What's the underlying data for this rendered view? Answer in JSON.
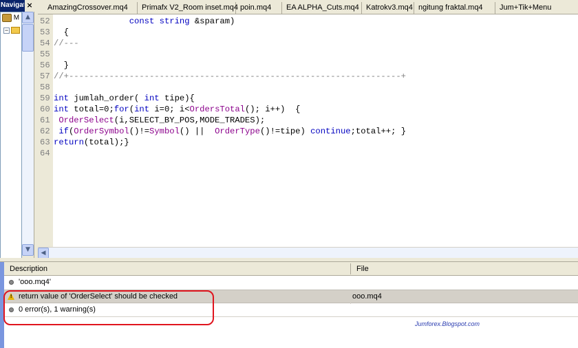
{
  "navigator": {
    "title": "Navigator",
    "close_glyph": "×",
    "tree": [
      {
        "label": "M",
        "icon": "expert-advisor-icon"
      },
      {
        "label": "",
        "icon": "folder-icon"
      }
    ]
  },
  "tabs": [
    {
      "label": "AmazingCrossover.mq4"
    },
    {
      "label": "Primafx V2_Room inset.mq4"
    },
    {
      "label": "poin.mq4"
    },
    {
      "label": "EA ALPHA_Cuts.mq4"
    },
    {
      "label": "Katrokv3.mq4"
    },
    {
      "label": "ngitung fraktal.mq4"
    },
    {
      "label": "Jum+Tik+Menu"
    }
  ],
  "editor": {
    "lines": [
      {
        "num": "52",
        "text": "               const string &sparam)"
      },
      {
        "num": "53",
        "text": "  {"
      },
      {
        "num": "54",
        "text": "//---"
      },
      {
        "num": "55",
        "text": ""
      },
      {
        "num": "56",
        "text": "  }"
      },
      {
        "num": "57",
        "text": "//+------------------------------------------------------------------+"
      },
      {
        "num": "58",
        "text": ""
      },
      {
        "num": "59",
        "text": "int jumlah_order( int tipe){"
      },
      {
        "num": "60",
        "text": "int total=0;for(int i=0; i<OrdersTotal(); i++)  {"
      },
      {
        "num": "61",
        "text": " OrderSelect(i,SELECT_BY_POS,MODE_TRADES);"
      },
      {
        "num": "62",
        "text": " if(OrderSymbol()!=Symbol() ||  OrderType()!=tipe) continue;total++; }"
      },
      {
        "num": "63",
        "text": "return(total);}"
      },
      {
        "num": "64",
        "text": ""
      }
    ]
  },
  "toolbox": {
    "columns": {
      "description": "Description",
      "file": "File"
    },
    "rows": [
      {
        "type": "info",
        "description": "'ooo.mq4'",
        "file": ""
      },
      {
        "type": "warning",
        "description": "return value of 'OrderSelect' should be checked",
        "file": "ooo.mq4"
      },
      {
        "type": "info",
        "description": "0 error(s), 1 warning(s)",
        "file": ""
      }
    ],
    "watermark": "Jumforex.Blogspot.com"
  },
  "colors": {
    "keyword": "#0000c0",
    "function": "#8b008b",
    "comment": "#808080",
    "highlight": "#e0141e",
    "nav_title_bg": "#0a246a"
  }
}
